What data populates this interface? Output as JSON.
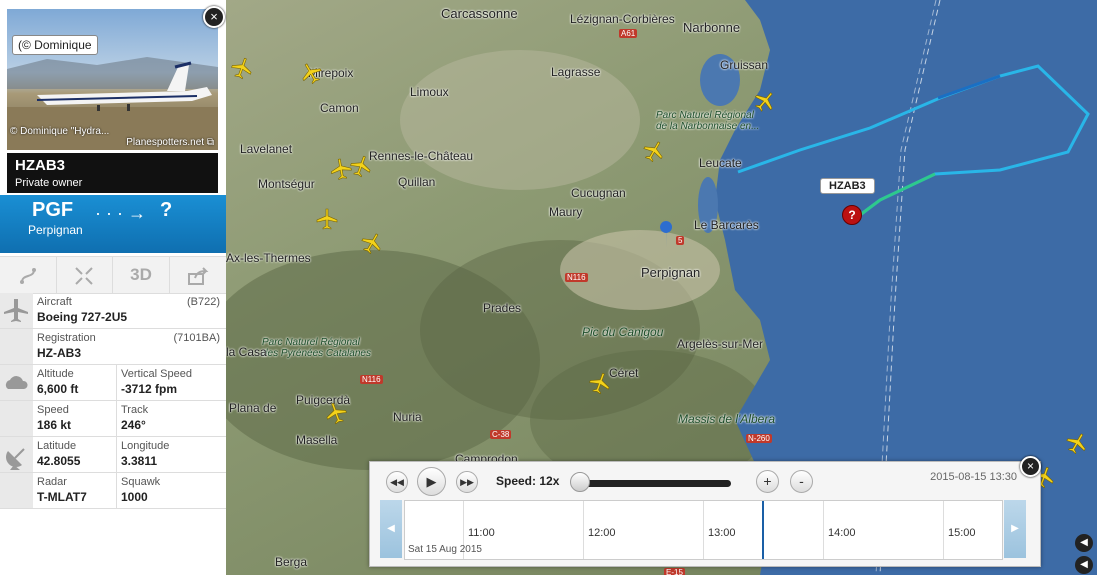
{
  "map": {
    "places": [
      {
        "name": "Carcassonne",
        "cls": "big"
      },
      {
        "name": "Lézignan-Corbières",
        "cls": ""
      },
      {
        "name": "Narbonne",
        "cls": "big"
      },
      {
        "name": "Gruissan",
        "cls": ""
      },
      {
        "name": "Mirepoix",
        "cls": ""
      },
      {
        "name": "Lagrasse",
        "cls": ""
      },
      {
        "name": "Limoux",
        "cls": ""
      },
      {
        "name": "Camon",
        "cls": ""
      },
      {
        "name": "Parc Naturel Régional de la Narbonnaise en...",
        "cls": ""
      },
      {
        "name": "Lavelanet",
        "cls": ""
      },
      {
        "name": "Rennes-le-Château",
        "cls": ""
      },
      {
        "name": "Leucate",
        "cls": ""
      },
      {
        "name": "Montségur",
        "cls": ""
      },
      {
        "name": "Quillan",
        "cls": ""
      },
      {
        "name": "Cucugnan",
        "cls": ""
      },
      {
        "name": "Maury",
        "cls": ""
      },
      {
        "name": "Le Barcarès",
        "cls": ""
      },
      {
        "name": "Ax-les-Thermes",
        "cls": ""
      },
      {
        "name": "Perpignan",
        "cls": "big"
      },
      {
        "name": "Prades",
        "cls": ""
      },
      {
        "name": "Pic du Canigou",
        "cls": ""
      },
      {
        "name": "Parc Naturel Régional des Pyrénées Catalanes",
        "cls": ""
      },
      {
        "name": "Argelès-sur-Mer",
        "cls": ""
      },
      {
        "name": "Puigcerdà",
        "cls": ""
      },
      {
        "name": "Céret",
        "cls": ""
      },
      {
        "name": "Massis de l'Albera",
        "cls": ""
      },
      {
        "name": "Masella",
        "cls": ""
      },
      {
        "name": "Nuria",
        "cls": ""
      },
      {
        "name": "Camprodon",
        "cls": ""
      },
      {
        "name": "Berga",
        "cls": ""
      },
      {
        "name": "la Casa",
        "cls": ""
      },
      {
        "name": "Plana de",
        "cls": ""
      }
    ],
    "roads": [
      "A61",
      "N116",
      "N116",
      "C-38",
      "N-260",
      "E-15",
      "5"
    ]
  },
  "photo": {
    "credit_top": "(© Dominique",
    "credit_bottom": "© Dominique \"Hydra...",
    "source": "Planespotters.net"
  },
  "flight": {
    "callsign": "HZAB3",
    "owner": "Private owner",
    "from_code": "PGF",
    "from_city": "Perpignan",
    "to_code": "?",
    "map_label": "HZAB3",
    "pin": "?"
  },
  "toolbar": {
    "threed": "3D"
  },
  "details": {
    "aircraft_label": "Aircraft",
    "aircraft_code": "(B722)",
    "aircraft_value": "Boeing 727-2U5",
    "registration_label": "Registration",
    "registration_code": "(7101BA)",
    "registration_value": "HZ-AB3",
    "altitude_label": "Altitude",
    "altitude_value": "6,600 ft",
    "vspeed_label": "Vertical Speed",
    "vspeed_value": "-3712 fpm",
    "speed_label": "Speed",
    "speed_value": "186 kt",
    "track_label": "Track",
    "track_value": "246°",
    "lat_label": "Latitude",
    "lat_value": "42.8055",
    "lon_label": "Longitude",
    "lon_value": "3.3811",
    "radar_label": "Radar",
    "radar_value": "T-MLAT7",
    "squawk_label": "Squawk",
    "squawk_value": "1000"
  },
  "playback": {
    "speed_label": "Speed: 12x",
    "datetime": "2015-08-15 13:30",
    "times": [
      "11:00",
      "12:00",
      "13:00",
      "14:00",
      "15:00"
    ],
    "date": "Sat 15 Aug 2015",
    "zoom_in": "+",
    "zoom_out": "-"
  },
  "colors": {
    "route_blue": "#1a8fd4",
    "track_cyan": "#29b6e8",
    "track_green": "#2ec98c",
    "pin_red": "#b11111"
  }
}
